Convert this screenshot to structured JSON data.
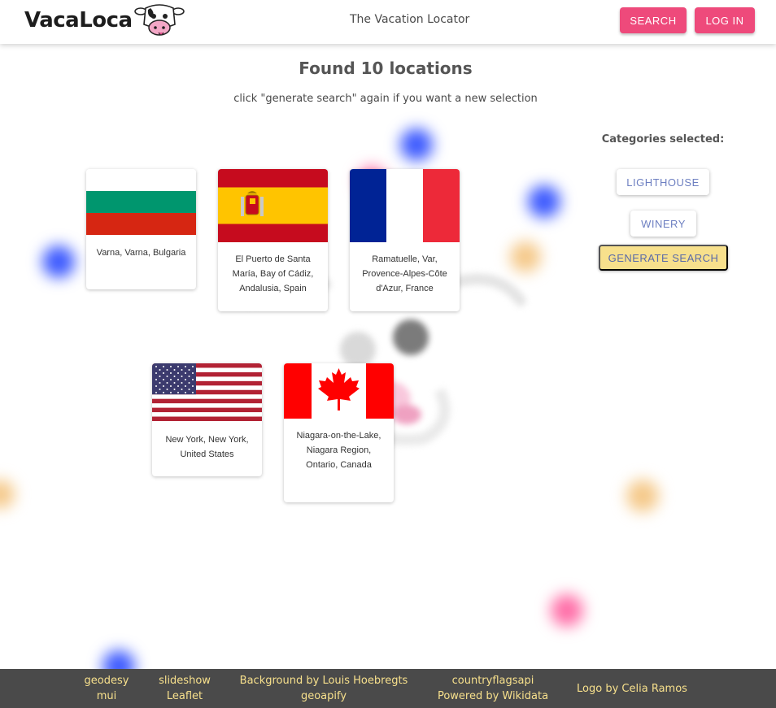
{
  "header": {
    "logo_text": "VacaLoca",
    "tagline": "The Vacation Locator",
    "search_label": "SEARCH",
    "login_label": "LOG IN",
    "accent_color": "#ee4a7b"
  },
  "results": {
    "title": "Found 10 locations",
    "hint": "click \"generate search\" again if you want a new selection"
  },
  "locations": [
    {
      "flag": "bulgaria-flag",
      "name": "Varna, Varna, Bulgaria"
    },
    {
      "flag": "spain-flag",
      "name": "El Puerto de Santa María, Bay of Cádiz, Andalusia, Spain"
    },
    {
      "flag": "france-flag",
      "name": "Ramatuelle, Var, Provence-Alpes-Côte d'Azur, France"
    },
    {
      "flag": "usa-flag",
      "name": "New York, New York, United States"
    },
    {
      "flag": "canada-flag",
      "name": "Niagara-on-the-Lake, Niagara Region, Ontario, Canada"
    }
  ],
  "categories": {
    "title": "Categories selected:",
    "items": [
      "LIGHTHOUSE",
      "WINERY"
    ],
    "generate_label": "GENERATE SEARCH",
    "generate_color": "#f7e08c"
  },
  "footer": {
    "columns": [
      [
        "geodesy",
        "mui"
      ],
      [
        "slideshow",
        "Leaflet"
      ],
      [
        "Background by Louis Hoebregts",
        "geoapify"
      ],
      [
        "countryflagsapi",
        "Powered by Wikidata"
      ],
      [
        "Logo by Celia Ramos"
      ]
    ],
    "link_color": "#f7e08c",
    "background": "#4a4a4a"
  }
}
